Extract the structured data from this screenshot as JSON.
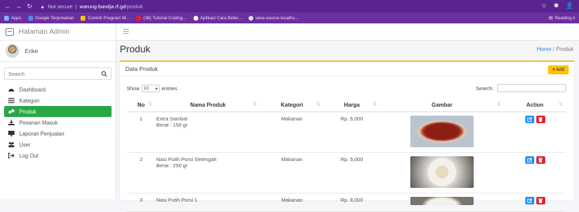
{
  "browser": {
    "url_security": "Not secure",
    "url_host": "warung-bandja.rf.gd",
    "url_path": "/produk",
    "bookmarks": [
      "Apps",
      "Google Terjemahan",
      "Contoh Program W...",
      "(38) Tutorial Coding...",
      "Aplikasi Cara Beler...",
      "view-source:localho..."
    ],
    "reading_list": "Reading li"
  },
  "sidebar": {
    "brand": "Halaman Admin",
    "user": "Erike",
    "search_placeholder": "Search",
    "items": [
      {
        "label": "Dashboard",
        "icon": "dashboard-icon"
      },
      {
        "label": "Kategori",
        "icon": "list-icon"
      },
      {
        "label": "Produk",
        "icon": "produk-icon",
        "active": true
      },
      {
        "label": "Pesanan Masuk",
        "icon": "download-icon"
      },
      {
        "label": "Laporan Penjualan",
        "icon": "report-icon"
      },
      {
        "label": "User",
        "icon": "users-icon"
      },
      {
        "label": "Log Out",
        "icon": "logout-icon"
      }
    ]
  },
  "main": {
    "title": "Produk",
    "breadcrumb": {
      "home": "Home",
      "sep": "/",
      "current": "Produk"
    },
    "card_title": "Data Produk",
    "add_label": "Add",
    "show_label": "Show",
    "entries_value": "10",
    "entries_label": "entries",
    "search_label": "Search:",
    "columns": [
      "No",
      "Nama Produk",
      "Kategori",
      "Harga",
      "Gambar",
      "Action"
    ],
    "rows": [
      {
        "no": "1",
        "nama": "Extra Sambal",
        "berat": "Berat : 150 gr",
        "kategori": "Makanan",
        "harga": "Rp. 5,000",
        "image": "sambal-bowl"
      },
      {
        "no": "2",
        "nama": "Nasi Putih Porsi Setengah",
        "berat": "Berat : 250 gr",
        "kategori": "Makanan",
        "harga": "Rp. 5,000",
        "image": "rice-plate"
      },
      {
        "no": "3",
        "nama": "Nasi Putih Porsi 1",
        "berat": "",
        "kategori": "Makanan",
        "harga": "Rp. 8,000",
        "image": "rice-plate"
      }
    ]
  },
  "colors": {
    "browser": "#6b2fa0",
    "active": "#28a745",
    "accent": "#ffc107",
    "edit": "#1e90ff",
    "delete": "#e0212f"
  }
}
